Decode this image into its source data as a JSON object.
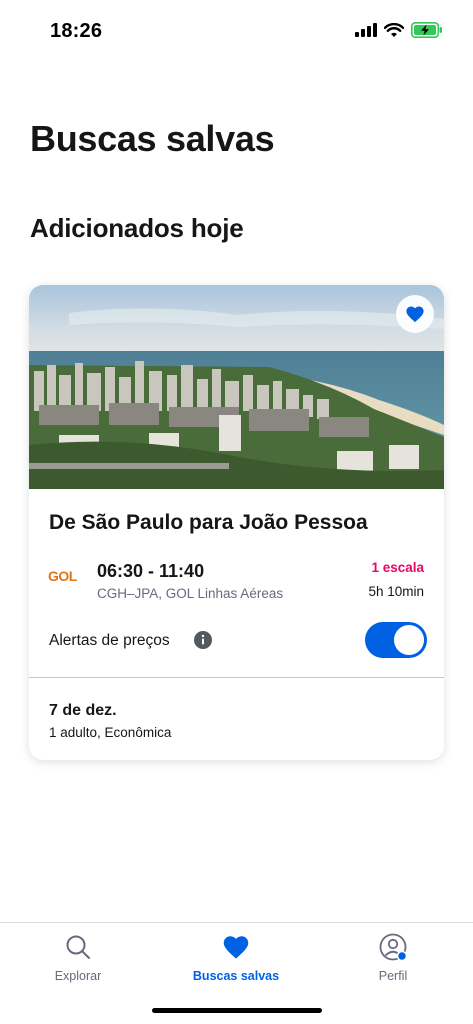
{
  "status_bar": {
    "time": "18:26"
  },
  "header": {
    "title": "Buscas salvas"
  },
  "section": {
    "title": "Adicionados hoje"
  },
  "saved_search": {
    "route": "De São Paulo para João Pessoa",
    "airline_logo": "GOL",
    "times": "06:30 - 11:40",
    "detail": "CGH–JPA, GOL Linhas Aéreas",
    "stops": "1 escala",
    "duration": "5h 10min",
    "alerts_label": "Alertas de preços",
    "alerts_enabled": true,
    "date": "7 de dez.",
    "passengers": "1 adulto, Econômica",
    "favorite_icon": "heart-icon"
  },
  "tabs": [
    {
      "label": "Explorar",
      "icon": "search-icon"
    },
    {
      "label": "Buscas salvas",
      "icon": "heart-icon",
      "active": true
    },
    {
      "label": "Perfil",
      "icon": "profile-icon"
    }
  ],
  "colors": {
    "accent": "#0062e3",
    "stops": "#e70866",
    "logo": "#e0761a"
  }
}
